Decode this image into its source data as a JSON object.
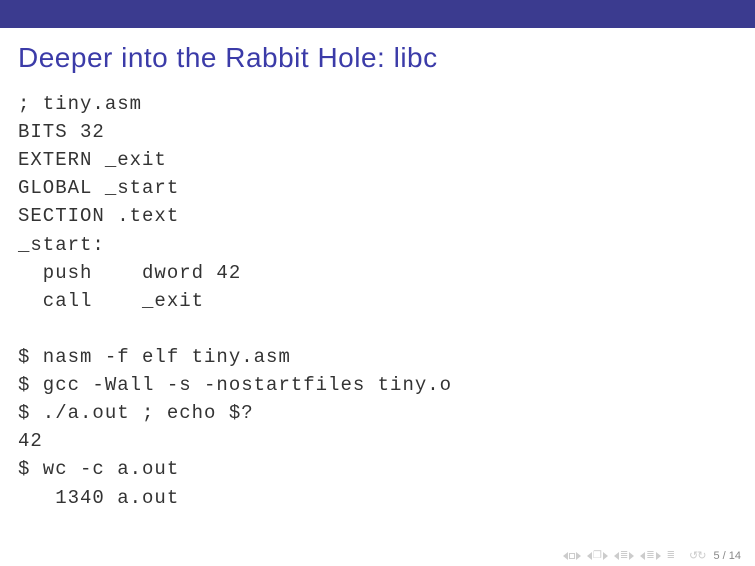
{
  "title": "Deeper into the Rabbit Hole: libc",
  "code": {
    "l1": "; tiny.asm",
    "l2": "BITS 32",
    "l3": "EXTERN _exit",
    "l4": "GLOBAL _start",
    "l5": "SECTION .text",
    "l6": "_start:",
    "l7": "  push    dword 42",
    "l8": "  call    _exit",
    "l9": "",
    "l10": "$ nasm -f elf tiny.asm",
    "l11": "$ gcc -Wall -s -nostartfiles tiny.o",
    "l12": "$ ./a.out ; echo $?",
    "l13": "42",
    "l14": "$ wc -c a.out",
    "l15": "   1340 a.out"
  },
  "pagenum": "5 / 14"
}
